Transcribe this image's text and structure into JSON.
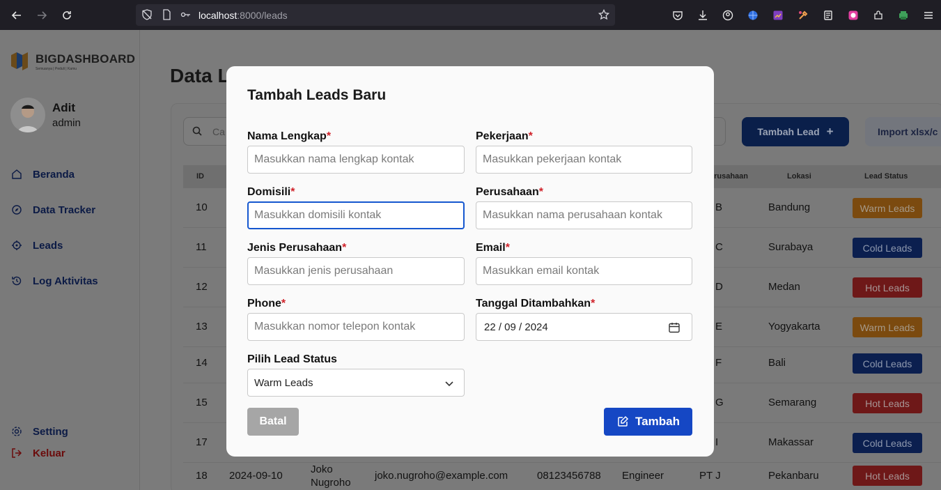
{
  "browser": {
    "url_host": "localhost",
    "url_rest": ":8000/leads"
  },
  "sidebar": {
    "logo_title": "BIGDASHBOARD",
    "logo_subtitle": "Semuanya | Peduli | Kamu",
    "user_name": "Adit",
    "user_role": "admin",
    "items": [
      {
        "label": "Beranda",
        "icon": "home-icon"
      },
      {
        "label": "Data Tracker",
        "icon": "compass-icon"
      },
      {
        "label": "Leads",
        "icon": "target-icon"
      },
      {
        "label": "Log Aktivitas",
        "icon": "history-icon"
      }
    ],
    "setting_label": "Setting",
    "logout_label": "Keluar"
  },
  "main": {
    "title": "Data Leads",
    "search_placeholder": "Ca",
    "add_lead_label": "Tambah Lead",
    "import_label": "Import xlsx/c",
    "columns": {
      "id": "ID",
      "perusahaan": "Perusahaan",
      "lokasi": "Lokasi",
      "status": "Lead Status"
    },
    "rows": [
      {
        "id": "10",
        "company": "B",
        "location": "Bandung",
        "status": "Warm Leads",
        "kind": "warm"
      },
      {
        "id": "11",
        "company": "C",
        "location": "Surabaya",
        "status": "Cold Leads",
        "kind": "cold"
      },
      {
        "id": "12",
        "company": "D",
        "location": "Medan",
        "status": "Hot Leads",
        "kind": "hot"
      },
      {
        "id": "13",
        "company": "E",
        "location": "Yogyakarta",
        "status": "Warm Leads",
        "kind": "warm"
      },
      {
        "id": "14",
        "company": "F",
        "location": "Bali",
        "status": "Cold Leads",
        "kind": "cold"
      },
      {
        "id": "15",
        "company": "G",
        "location": "Semarang",
        "status": "Hot Leads",
        "kind": "hot"
      },
      {
        "id": "17",
        "company": "I",
        "location": "Makassar",
        "status": "Cold Leads",
        "kind": "cold"
      },
      {
        "id": "18",
        "date": "2024-09-10",
        "name": "Joko Nugroho",
        "email": "joko.nugroho@example.com",
        "phone": "08123456788",
        "job": "Engineer",
        "company": "PT J",
        "location": "Pekanbaru",
        "status": "Hot Leads",
        "kind": "hot"
      }
    ]
  },
  "modal": {
    "title": "Tambah Leads Baru",
    "fields": {
      "nama": {
        "label": "Nama Lengkap",
        "placeholder": "Masukkan nama lengkap kontak"
      },
      "pekerjaan": {
        "label": "Pekerjaan",
        "placeholder": "Masukkan pekerjaan kontak"
      },
      "domisili": {
        "label": "Domisili",
        "placeholder": "Masukkan domisili kontak"
      },
      "perusahaan": {
        "label": "Perusahaan",
        "placeholder": "Masukkan nama perusahaan kontak"
      },
      "jenis": {
        "label": "Jenis Perusahaan",
        "placeholder": "Masukkan jenis perusahaan"
      },
      "email": {
        "label": "Email",
        "placeholder": "Masukkan email kontak"
      },
      "phone": {
        "label": "Phone",
        "placeholder": "Masukkan nomor telepon kontak"
      },
      "tanggal": {
        "label": "Tanggal Ditambahkan",
        "value": "22 / 09 / 2024"
      },
      "status": {
        "label": "Pilih Lead Status",
        "value": "Warm Leads"
      }
    },
    "required_mark": "*",
    "cancel_label": "Batal",
    "submit_label": "Tambah"
  }
}
